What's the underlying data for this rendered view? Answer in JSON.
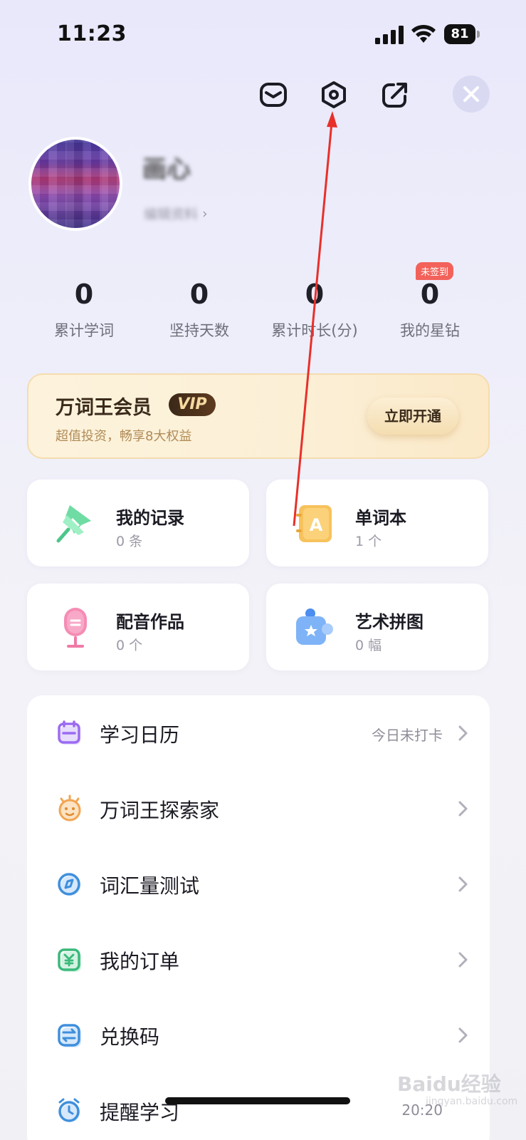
{
  "status_bar": {
    "time": "11:23",
    "battery": "81"
  },
  "header": {
    "icons": [
      "mail-icon",
      "settings-icon",
      "share-icon",
      "close-icon"
    ]
  },
  "profile": {
    "username": "画心",
    "link_label": "编辑资料",
    "chevron": "›"
  },
  "stats": [
    {
      "value": "0",
      "label": "累计学词"
    },
    {
      "value": "0",
      "label": "坚持天数"
    },
    {
      "value": "0",
      "label": "累计时长(分)"
    },
    {
      "value": "0",
      "label": "我的星钻",
      "badge": "未签到"
    }
  ],
  "vip": {
    "title": "万词王会员",
    "badge": "VIP",
    "subtitle": "超值投资，畅享8大权益",
    "button": "立即开通"
  },
  "tiles": [
    {
      "title": "我的记录",
      "count": "0 条",
      "icon": "pin-icon"
    },
    {
      "title": "单词本",
      "count": "1 个",
      "icon": "notebook-icon"
    },
    {
      "title": "配音作品",
      "count": "0 个",
      "icon": "microphone-icon"
    },
    {
      "title": "艺术拼图",
      "count": "0 幅",
      "icon": "puzzle-icon"
    }
  ],
  "menu": [
    {
      "label": "学习日历",
      "right": "今日未打卡",
      "icon": "calendar-icon"
    },
    {
      "label": "万词王探索家",
      "right": "",
      "icon": "explorer-icon"
    },
    {
      "label": "词汇量测试",
      "right": "",
      "icon": "compass-icon"
    },
    {
      "label": "我的订单",
      "right": "",
      "icon": "order-icon"
    },
    {
      "label": "兑换码",
      "right": "",
      "icon": "exchange-icon"
    },
    {
      "label": "提醒学习",
      "right": "20:20",
      "icon": "alarm-icon"
    }
  ],
  "watermark": {
    "text": "Baidu经验",
    "sub": "jingyan.baidu.com"
  },
  "colors": {
    "accent_red": "#e8302a",
    "vip_gold": "#f6d9a0",
    "badge_red": "#f2625a"
  }
}
